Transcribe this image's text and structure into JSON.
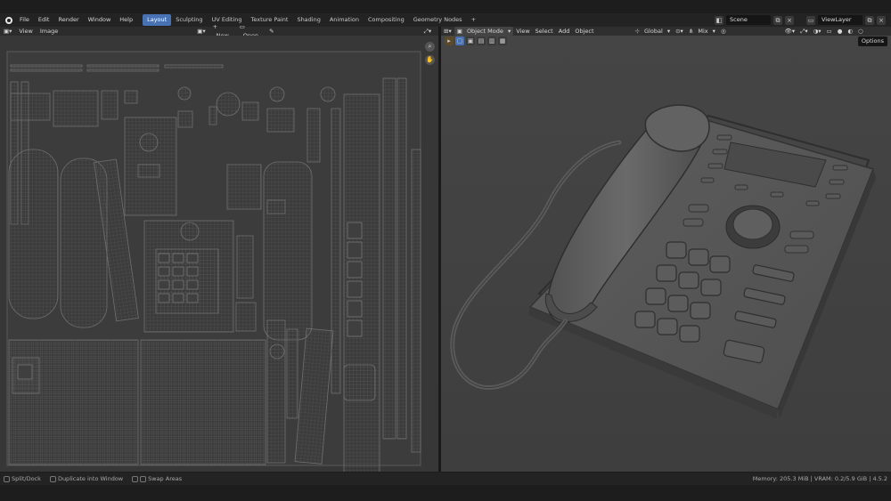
{
  "topbar": {
    "menus": [
      "File",
      "Edit",
      "Render",
      "Window",
      "Help"
    ],
    "workspaces": [
      "Layout",
      "Sculpting",
      "UV Editing",
      "Texture Paint",
      "Shading",
      "Animation",
      "Compositing",
      "Geometry Nodes"
    ],
    "active_workspace": "Layout",
    "add_tab": "+",
    "scene": "Scene",
    "view_layer": "ViewLayer"
  },
  "uv_editor": {
    "menus": [
      "View",
      "Image"
    ],
    "new_label": "New",
    "open_label": "Open"
  },
  "viewport": {
    "mode": "Object Mode",
    "menus": [
      "View",
      "Select",
      "Add",
      "Object"
    ],
    "orientation": "Global",
    "proportional": "Mix",
    "options_label": "Options"
  },
  "statusbar": {
    "left": [
      "Split/Dock",
      "Duplicate into Window",
      "Swap Areas"
    ],
    "right": "Memory: 205.3 MiB | VRAM: 0.2/5.9 GiB | 4.5.2"
  },
  "colors": {
    "accent": "#4772b3",
    "panel": "#363636",
    "viewport_bg": "#3d3d3d",
    "header": "#2c2c2c"
  },
  "icons": {
    "blender_logo": "blender-logo-icon",
    "zoom": "magnifier-icon",
    "pan": "hand-icon"
  }
}
